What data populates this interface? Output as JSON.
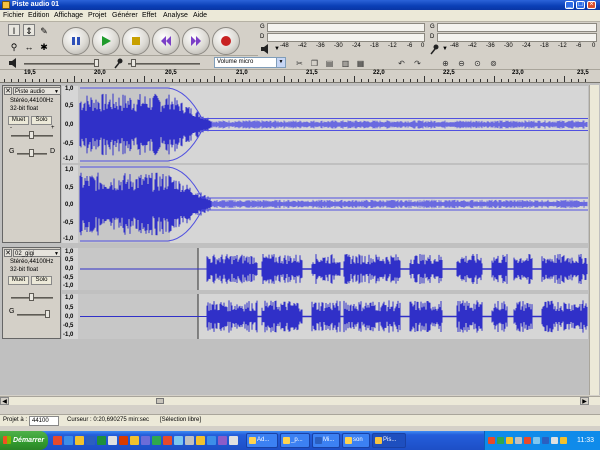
{
  "window": {
    "title": "Piste audio 01"
  },
  "menu": [
    "Fichier",
    "Edition",
    "Affichage",
    "Projet",
    "Générer",
    "Effet",
    "Analyse",
    "Aide"
  ],
  "tools": {
    "selection_glyph": "I",
    "envelope_glyph": "⇕",
    "draw_glyph": "✎",
    "zoom_glyph": "⚲",
    "timeshift_glyph": "↔",
    "multi_glyph": "✱"
  },
  "meters": {
    "channel_left": "G",
    "channel_right": "D",
    "scale": [
      "-48",
      "-42",
      "-36",
      "-30",
      "-24",
      "-18",
      "-12",
      "-6",
      "0"
    ]
  },
  "edit_toolbar": {
    "input_device": "Volume micro"
  },
  "ruler": {
    "labels": [
      "19,5",
      "20,0",
      "20,5",
      "21,0",
      "21,5",
      "22,0",
      "22,5",
      "23,0",
      "23,5"
    ]
  },
  "tracks": [
    {
      "name": "Piste audio",
      "format": "Stéréo,44100Hz",
      "depth": "32-bit float",
      "mute": "Muet",
      "solo": "Solo",
      "pan_left": "G",
      "pan_right": "D",
      "minus": "-",
      "plus": "+",
      "scale_top": [
        "1,0",
        "0,5",
        "0,0",
        "-0,5",
        "-1,0"
      ],
      "scale_bottom": [
        "1,0",
        "0,5",
        "0,0",
        "-0,5",
        "-1,0"
      ]
    },
    {
      "name": "02_gigi",
      "format": "Stéréo,44100Hz",
      "depth": "32-bit float",
      "mute": "Muet",
      "solo": "Solo",
      "pan_left": "G",
      "pan_right": "D",
      "scale_top": [
        "1,0",
        "0,5",
        "0,0",
        "-0,5",
        "-1,0"
      ],
      "scale_bottom": [
        "1,0",
        "0,5",
        "0,0",
        "-0,5",
        "-1,0"
      ]
    }
  ],
  "status": {
    "project_rate_label": "Projet à :",
    "project_rate": "44100",
    "cursor_text": "Curseur : 0:20,690275 min:sec",
    "selection": "[Sélection libre]"
  },
  "taskbar": {
    "start_label": "Démarrer",
    "tasks": [
      "Ad...",
      "_p...",
      "Mi...",
      "son",
      "Pis..."
    ],
    "clock": "11:33"
  },
  "colors": {
    "waveform": "#3030c8",
    "waveform_light": "#6a6ae0",
    "track_bg": "#d6d6d6",
    "selection_bg": "#c7c7c7"
  }
}
